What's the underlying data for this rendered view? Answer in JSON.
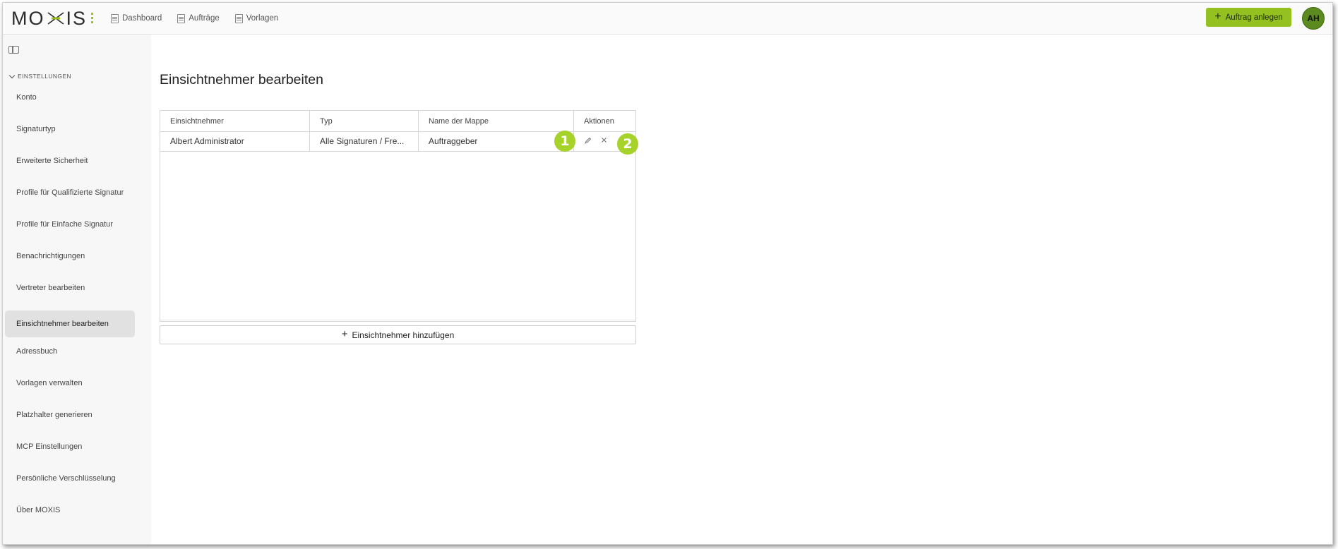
{
  "header": {
    "logo_left": "MO",
    "logo_right": "IS",
    "nav": [
      {
        "label": "Dashboard",
        "icon": "document-icon"
      },
      {
        "label": "Aufträge",
        "icon": "document-icon"
      },
      {
        "label": "Vorlagen",
        "icon": "document-icon"
      }
    ],
    "create_button": "Auftrag anlegen",
    "avatar_initials": "AH"
  },
  "sidebar": {
    "section_label": "EINSTELLUNGEN",
    "items": [
      {
        "label": "Konto"
      },
      {
        "label": "Signaturtyp"
      },
      {
        "label": "Erweiterte Sicherheit"
      },
      {
        "label": "Profile für Qualifizierte Signatur"
      },
      {
        "label": "Profile für Einfache Signatur"
      },
      {
        "label": "Benachrichtigungen"
      },
      {
        "label": "Vertreter bearbeiten"
      },
      {
        "label": "Einsichtnehmer bearbeiten",
        "active": true
      },
      {
        "label": "Adressbuch"
      },
      {
        "label": "Vorlagen verwalten"
      },
      {
        "label": "Platzhalter generieren"
      },
      {
        "label": "MCP Einstellungen"
      },
      {
        "label": "Persönliche Verschlüsselung"
      },
      {
        "label": "Über MOXIS"
      }
    ]
  },
  "main": {
    "title": "Einsichtnehmer bearbeiten",
    "table": {
      "columns": [
        "Einsichtnehmer",
        "Typ",
        "Name der Mappe",
        "Aktionen"
      ],
      "rows": [
        {
          "einsichtnehmer": "Albert Administrator",
          "typ": "Alle Signaturen / Fre...",
          "mappe": "Auftraggeber"
        }
      ]
    },
    "add_button": "Einsichtnehmer hinzufügen"
  },
  "annotations": {
    "marker1": "1",
    "marker2": "2"
  },
  "colors": {
    "accent": "#94c11f",
    "marker": "#a6d22a",
    "avatar": "#5b8a1e"
  }
}
